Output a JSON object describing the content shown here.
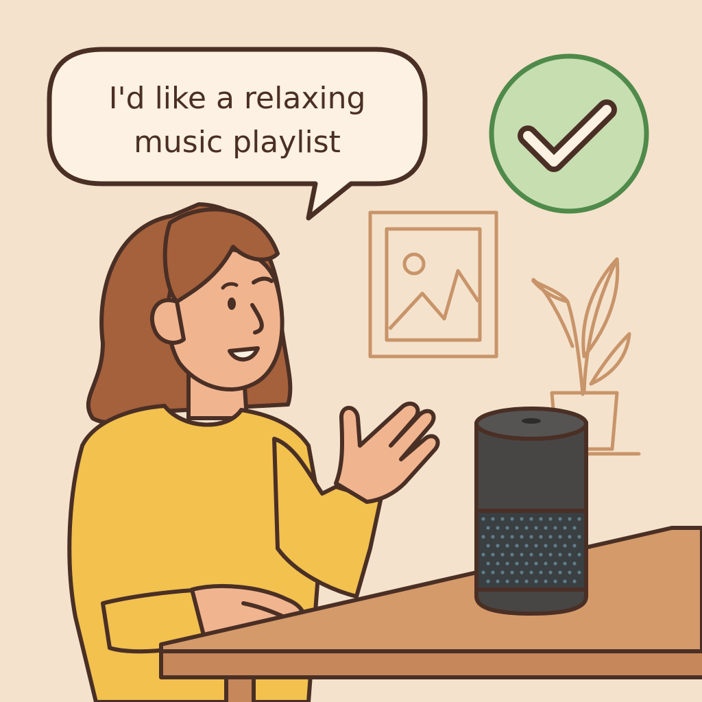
{
  "speech_bubble": {
    "line1": "I'd like a relaxing",
    "line2": "music playlist"
  },
  "colors": {
    "background": "#f4e2cc",
    "outline": "#4a2f25",
    "bubble_fill": "#fcf1e2",
    "check_fill": "#c7deb0",
    "check_stroke": "#4f8a4a",
    "frame_stroke": "#c8946a",
    "hair": "#a5603c",
    "skin": "#f0b48f",
    "sweater": "#f2c14e",
    "table": "#d59a6a",
    "speaker_top": "#474645",
    "speaker_grille": "#3a3f42",
    "grille_dots": "#5f7d8a"
  },
  "icons": {
    "status": "checkmark-circle-icon",
    "frame": "picture-frame-icon",
    "plant": "potted-plant-icon",
    "device": "smart-speaker-icon"
  }
}
